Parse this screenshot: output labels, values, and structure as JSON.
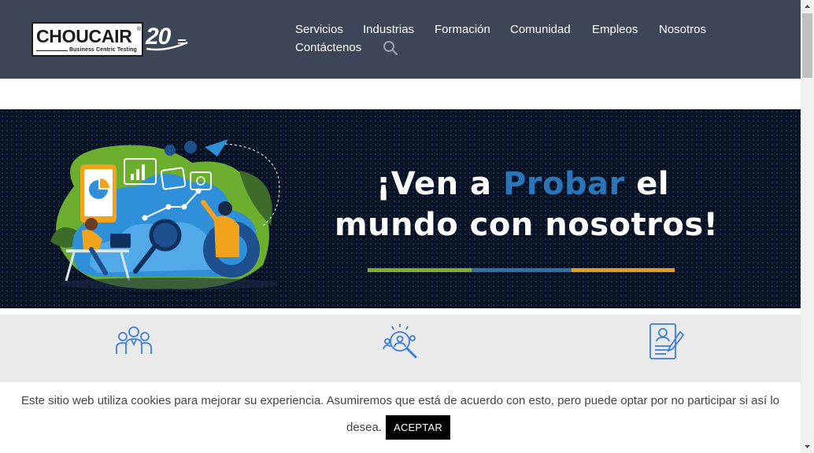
{
  "header": {
    "logo": {
      "brand": "CHOUCAIR",
      "registered": "®",
      "tagline": "Business Centric Testing",
      "anniversary": "20"
    },
    "nav": [
      "Servicios",
      "Industrias",
      "Formación",
      "Comunidad",
      "Empleos",
      "Nosotros",
      "Contáctenos"
    ],
    "search_icon": "search-icon"
  },
  "banner": {
    "headline_line1_pre": "¡Ven a ",
    "headline_line1_accent": "Probar",
    "headline_line1_post": " el",
    "headline_line2": "mundo con nosotros!",
    "colors": {
      "accent": "#2b76b9",
      "bar_green": "#7fad2e",
      "bar_blue": "#2f6ea8",
      "bar_orange": "#e39b1a",
      "background": "#0a1324"
    }
  },
  "features": {
    "icons": [
      "team-icon",
      "people-search-icon",
      "resume-document-icon"
    ],
    "icon_color": "#3b7ddd"
  },
  "cookie": {
    "text_line1": "Este sitio web utiliza cookies para mejorar su experiencia. Asumiremos que está de acuerdo con esto, pero puede optar por no participar si así lo",
    "text_line2": "desea.",
    "accept_label": "ACEPTAR"
  },
  "colors": {
    "header_bg": "#3d4656",
    "nav_text": "#ffffff"
  }
}
